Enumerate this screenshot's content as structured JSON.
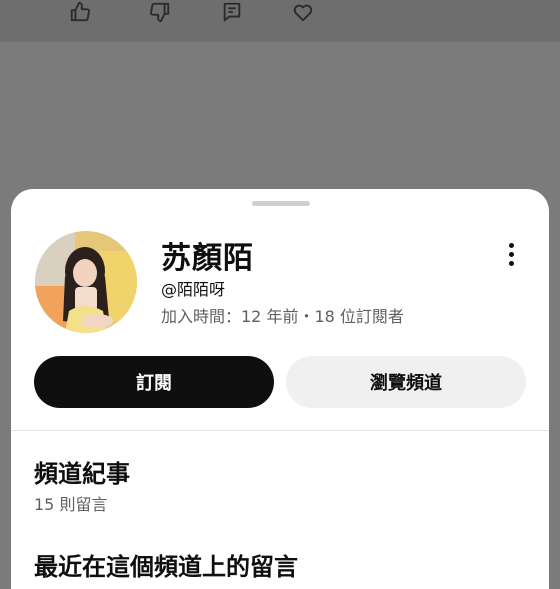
{
  "background_colors": {
    "overlay": "#7b7b7b",
    "topbar": "#6e6e6e",
    "sheet": "#ffffff"
  },
  "top_actions": [
    {
      "icon": "thumb-up-icon"
    },
    {
      "icon": "thumb-down-icon"
    },
    {
      "icon": "comment-icon"
    },
    {
      "icon": "heart-icon"
    }
  ],
  "channel": {
    "name": "苏顏陌",
    "handle": "@陌陌呀",
    "meta": "加入時間：12 年前・18 位訂閱者",
    "avatar_icon": "channel-avatar"
  },
  "buttons": {
    "subscribe": "訂閱",
    "browse": "瀏覽頻道",
    "subscribe_color": "#0f0f0f",
    "browse_color": "#f0f0f0"
  },
  "section": {
    "title": "頻道紀事",
    "count": "15 則留言"
  },
  "next_section": {
    "title": "最近在這個頻道上的留言"
  }
}
